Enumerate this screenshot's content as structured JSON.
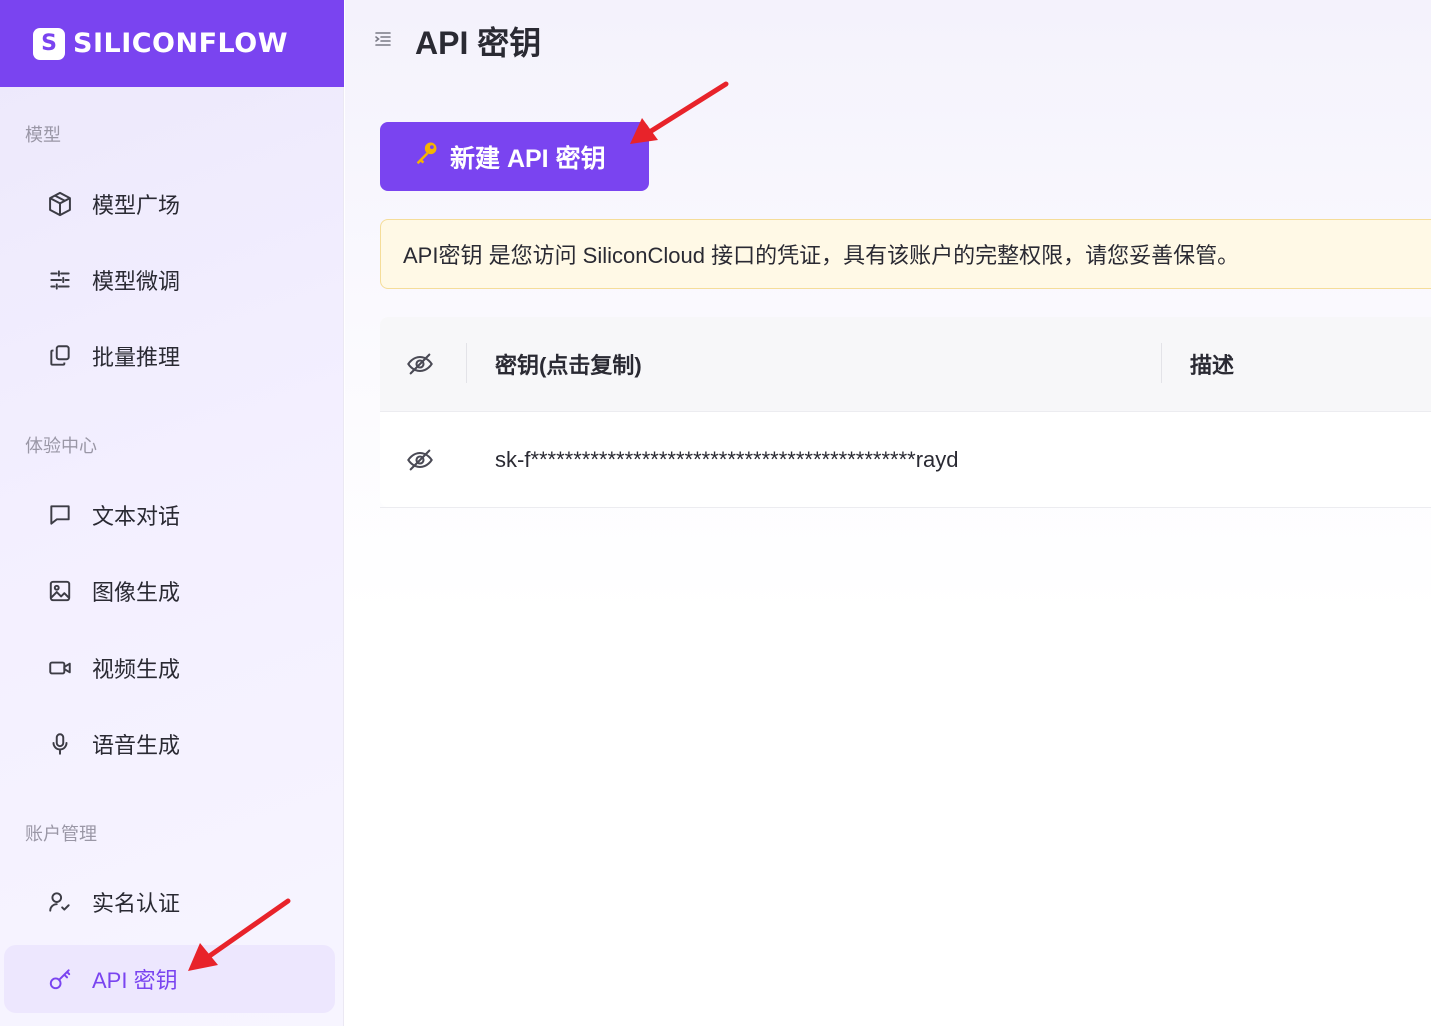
{
  "brand": {
    "logo_text": "SILICONFLOW",
    "logo_mark": "S"
  },
  "sidebar": {
    "sections": [
      {
        "label": "模型"
      },
      {
        "label": "体验中心"
      },
      {
        "label": "账户管理"
      }
    ],
    "items": [
      {
        "label": "模型广场",
        "icon": "cube-icon"
      },
      {
        "label": "模型微调",
        "icon": "sliders-icon"
      },
      {
        "label": "批量推理",
        "icon": "copy-stack-icon"
      },
      {
        "label": "文本对话",
        "icon": "chat-icon"
      },
      {
        "label": "图像生成",
        "icon": "image-icon"
      },
      {
        "label": "视频生成",
        "icon": "video-icon"
      },
      {
        "label": "语音生成",
        "icon": "microphone-icon"
      },
      {
        "label": "实名认证",
        "icon": "user-check-icon"
      },
      {
        "label": "API 密钥",
        "icon": "key-icon",
        "active": true
      }
    ]
  },
  "header": {
    "title": "API 密钥"
  },
  "actions": {
    "new_key_label": "新建 API 密钥"
  },
  "notice": {
    "text": "API密钥 是您访问 SiliconCloud 接口的凭证，具有该账户的完整权限，请您妥善保管。"
  },
  "table": {
    "columns": [
      "密钥(点击复制)",
      "描述"
    ],
    "rows": [
      {
        "key": "sk-f*********************************************rayd",
        "description": ""
      }
    ]
  },
  "colors": {
    "accent": "#7a44f0",
    "notice_bg": "#fff9e6",
    "annotation_arrow": "#e8232a"
  }
}
